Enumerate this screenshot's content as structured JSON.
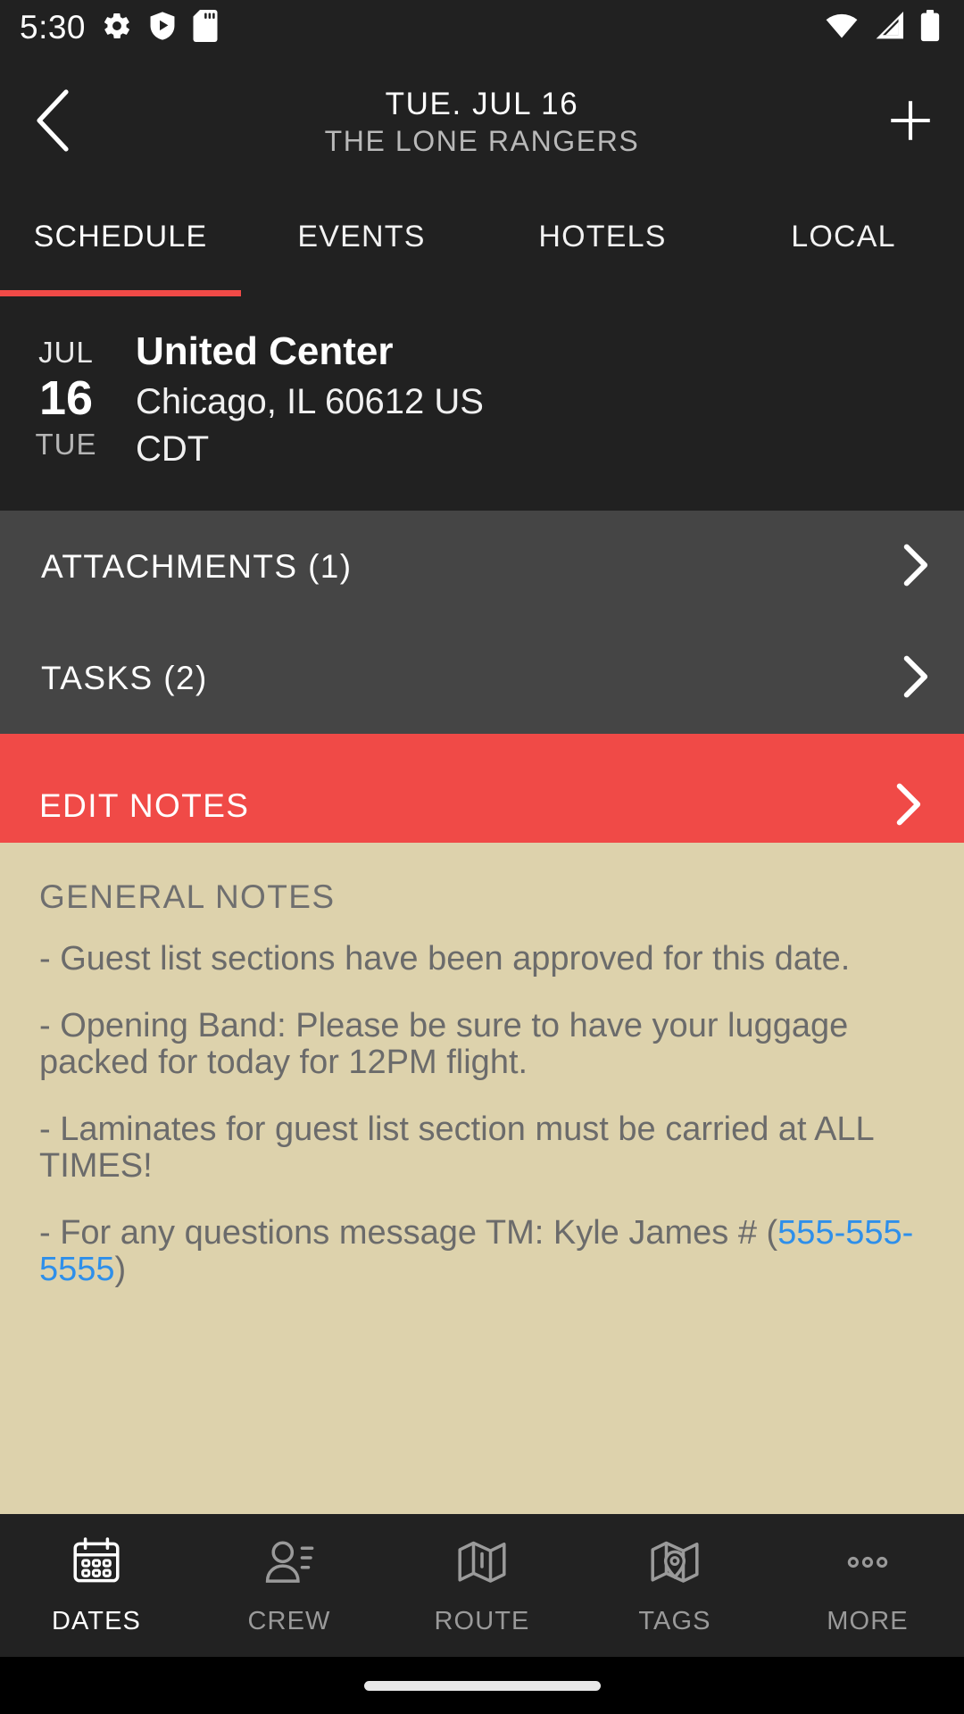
{
  "status_bar": {
    "time": "5:30",
    "left_icons": [
      "gear-icon",
      "shield-play-icon",
      "sd-card-icon"
    ],
    "right_icons": [
      "wifi-icon",
      "cellular-signal-icon",
      "battery-icon"
    ]
  },
  "header": {
    "back_icon": "chevron-left-icon",
    "title": "TUE. JUL 16",
    "subtitle": "THE LONE RANGERS",
    "add_icon": "plus-icon"
  },
  "tabs": {
    "items": [
      {
        "label": "SCHEDULE",
        "active": true
      },
      {
        "label": "EVENTS",
        "active": false
      },
      {
        "label": "HOTELS",
        "active": false
      },
      {
        "label": "LOCAL",
        "active": false
      }
    ],
    "indicator_color": "#f04a47"
  },
  "venue": {
    "month": "JUL",
    "day": "16",
    "weekday": "TUE",
    "name": "United Center",
    "address": "Chicago, IL 60612 US",
    "timezone": "CDT"
  },
  "action_rows": [
    {
      "label": "ATTACHMENTS (1)",
      "chevron": "chevron-right-icon",
      "style": "default"
    },
    {
      "label": "TASKS (2)",
      "chevron": "chevron-right-icon",
      "style": "default"
    },
    {
      "label": "EDIT NOTES",
      "chevron": "chevron-right-icon",
      "style": "accent"
    }
  ],
  "notes": {
    "background_color": "#ddd2ac",
    "title": "GENERAL NOTES",
    "paragraphs": [
      "- Guest list sections have been approved for this date.",
      "- Opening Band: Please be sure to have your luggage packed for today for 12PM flight.",
      "- Laminates for guest list section must be carried at ALL TIMES!"
    ],
    "last_paragraph_prefix": "-  For any questions message TM: Kyle James # (",
    "phone": "555-555-5555",
    "last_paragraph_suffix": ")"
  },
  "bottom_nav": {
    "items": [
      {
        "label": "DATES",
        "icon": "calendar-icon",
        "active": true
      },
      {
        "label": "CREW",
        "icon": "person-list-icon",
        "active": false
      },
      {
        "label": "ROUTE",
        "icon": "map-icon",
        "active": false
      },
      {
        "label": "TAGS",
        "icon": "map-pin-icon",
        "active": false
      },
      {
        "label": "MORE",
        "icon": "ellipsis-icon",
        "active": false
      }
    ]
  },
  "colors": {
    "accent_red": "#f04a47",
    "dark_bg": "#212121",
    "row_bg": "#454545",
    "notes_bg": "#ddd2ac",
    "link_blue": "#2e8fea"
  }
}
